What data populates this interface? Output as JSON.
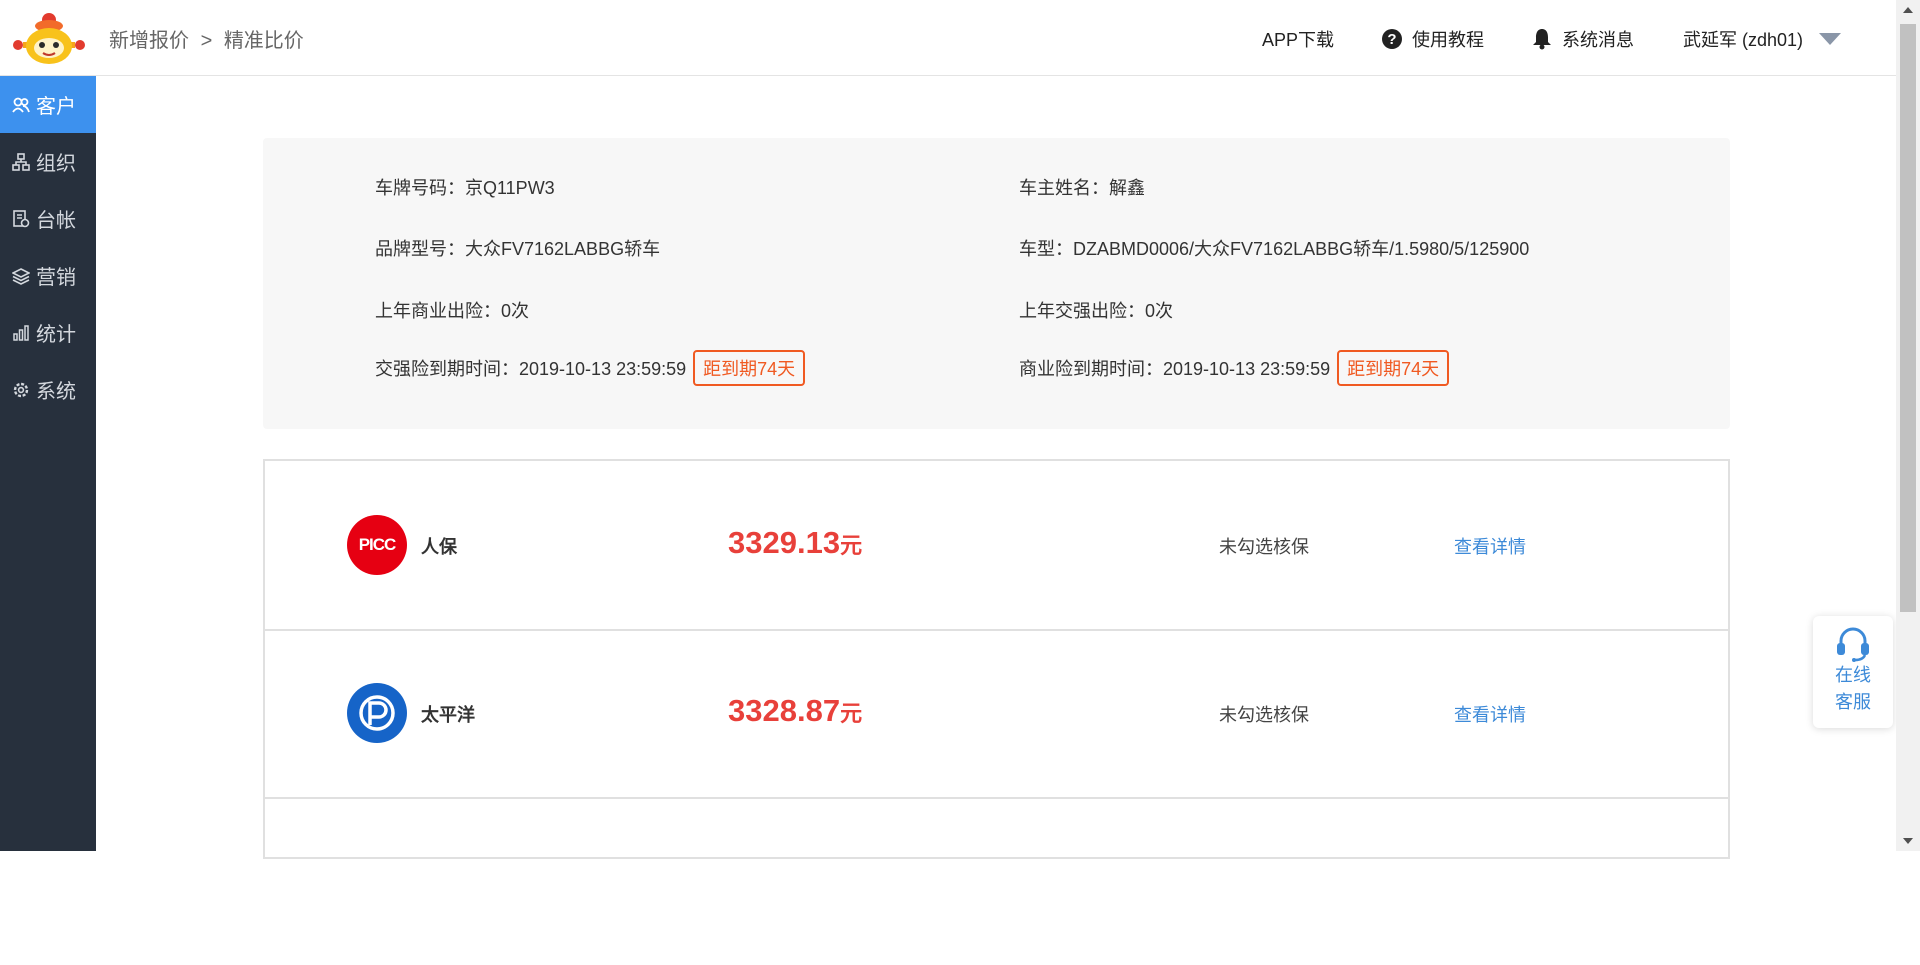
{
  "header": {
    "breadcrumb": [
      "新增报价",
      ">",
      "精准比价"
    ],
    "nav": {
      "app_download": "APP下载",
      "tutorial": "使用教程",
      "messages": "系统消息",
      "user": "武延军 (zdh01)"
    }
  },
  "sidebar": {
    "items": [
      {
        "label": "客户",
        "icon": "users-icon",
        "active": true
      },
      {
        "label": "组织",
        "icon": "org-chart-icon",
        "active": false
      },
      {
        "label": "台帐",
        "icon": "ledger-icon",
        "active": false
      },
      {
        "label": "营销",
        "icon": "layers-icon",
        "active": false
      },
      {
        "label": "统计",
        "icon": "bar-chart-icon",
        "active": false
      },
      {
        "label": "系统",
        "icon": "gear-icon",
        "active": false
      }
    ]
  },
  "vehicle": {
    "plate": "车牌号码：京Q11PW3",
    "owner": "车主姓名：解鑫",
    "brand_model": "品牌型号：大众FV7162LABBG轿车",
    "model_code": "车型：DZABMD0006/大众FV7162LABBG轿车/1.5980/5/125900",
    "last_commercial_claims": "上年商业出险：0次",
    "last_compulsory_claims": "上年交强出险：0次",
    "compulsory_expiry": "交强险到期时间：2019-10-13 23:59:59",
    "compulsory_badge": "距到期74天",
    "commercial_expiry": "商业险到期时间：2019-10-13 23:59:59",
    "commercial_badge": "距到期74天"
  },
  "quotes": [
    {
      "company": "人保",
      "logo_text": "PICC",
      "price": "3329.13",
      "unit": "元",
      "status": "未勾选核保",
      "link": "查看详情",
      "logo_color": "#e60012"
    },
    {
      "company": "太平洋",
      "logo_text": "P",
      "price": "3328.87",
      "unit": "元",
      "status": "未勾选核保",
      "link": "查看详情",
      "logo_color": "#1664c8"
    }
  ],
  "service": {
    "line1": "在线",
    "line2": "客服"
  },
  "colors": {
    "accent": "#3d91ee",
    "sidebar_bg": "#27303d",
    "price": "#e8403a",
    "badge": "#f05a22",
    "link": "#3d8ad8"
  }
}
